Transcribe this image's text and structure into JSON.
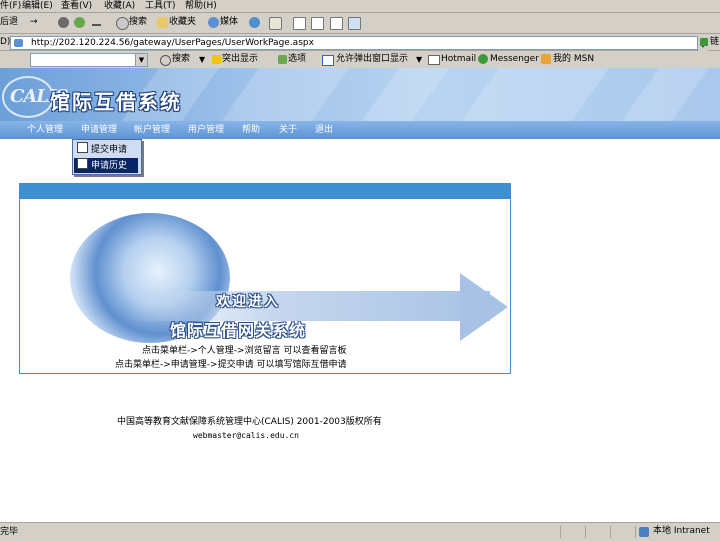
{
  "menubar": {
    "items": [
      "件(F)",
      "编辑(E)",
      "查看(V)",
      "收藏(A)",
      "工具(T)",
      "帮助(H)"
    ]
  },
  "toolbar": {
    "back": "后退",
    "forward_arrow": "→",
    "search": "搜索",
    "favorites": "收藏夹",
    "media": "媒体"
  },
  "address": {
    "label": "D)",
    "url": "http://202.120.224.56/gateway/UserPages/UserWorkPage.aspx",
    "links_label": "链"
  },
  "linksbar": {
    "search": "搜索",
    "highlight": "突出显示",
    "options": "选项",
    "popups": "允许弹出窗口显示",
    "hotmail": "Hotmail",
    "messenger": "Messenger",
    "msn": "我的 MSN"
  },
  "banner": {
    "logo": "CALIS",
    "title": "馆际互借系统"
  },
  "nav": {
    "items": [
      "个人管理",
      "申请管理",
      "帐户管理",
      "用户管理",
      "帮助",
      "关于",
      "退出"
    ]
  },
  "dropdown": {
    "items": [
      "提交申请",
      "申请历史"
    ],
    "selected": 1
  },
  "welcome": {
    "line1": "欢迎进入",
    "line2": "馆际互借网关系统",
    "help1": "点击菜单栏->个人管理->浏览留言 可以查看留言板",
    "help2": "点击菜单栏->申请管理->提交申请 可以填写馆际互借申请"
  },
  "footer": {
    "copyright": "中国高等教育文献保障系统管理中心(CALIS) 2001-2003版权所有",
    "email": "webmaster@calis.edu.cn"
  },
  "status": {
    "left": "完毕",
    "zone": "本地 Intranet"
  },
  "colors": {
    "chrome": "#d4d0c8",
    "nav_blue": "#5d93d6",
    "box_border": "#3f8fd4",
    "menu_highlight": "#0a246a"
  }
}
